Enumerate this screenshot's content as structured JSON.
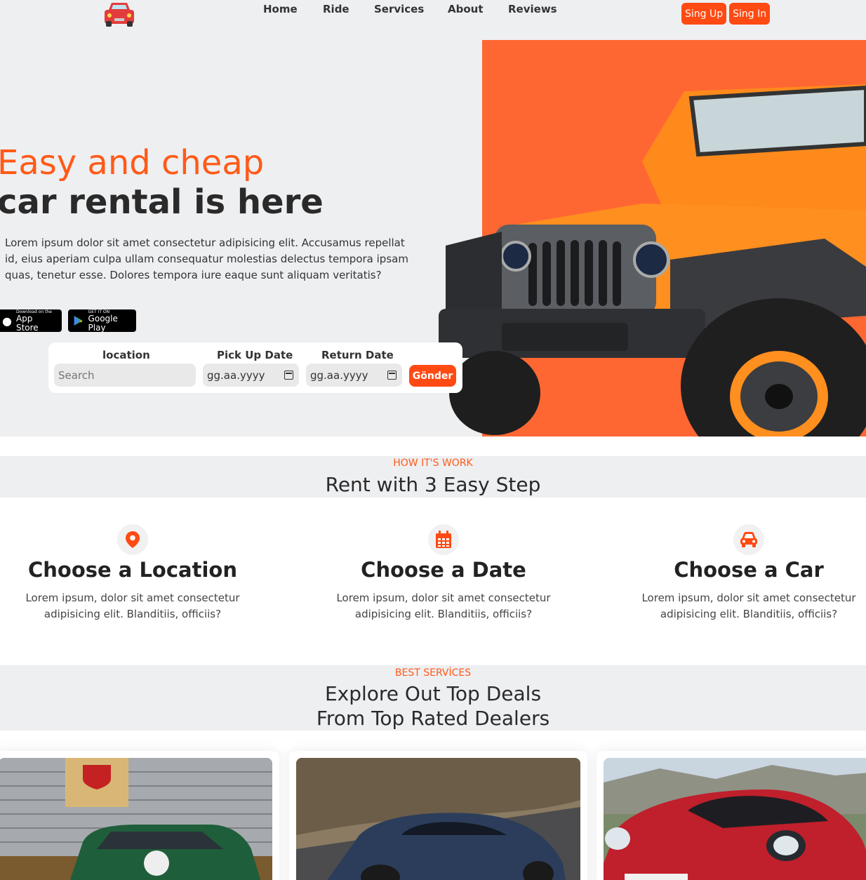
{
  "nav": {
    "items": [
      "Home",
      "Ride",
      "Services",
      "About",
      "Reviews"
    ],
    "signup_label": "Sing Up",
    "signin_label": "Sing In"
  },
  "hero": {
    "title_line1": "Easy and cheap",
    "title_line2": "car rental is here",
    "text": "Lorem ipsum dolor sit amet consectetur adipisicing elit. Accusamus repellat id, eius aperiam culpa ullam consequatur molestias delectus tempora ipsam quas, tenetur esse. Dolores tempora iure eaque sunt aliquam veritatis?",
    "app_store": {
      "small": "Download on the",
      "big": "App Store"
    },
    "google_play": {
      "small": "GET IT ON",
      "big": "Google Play"
    }
  },
  "search": {
    "location_label": "location",
    "location_placeholder": "Search",
    "pickup_label": "Pick Up Date",
    "pickup_value": "gg.aa.yyyy",
    "return_label": "Return Date",
    "return_value": "gg.aa.yyyy",
    "submit_label": "Gönder"
  },
  "how": {
    "kicker": "HOW IT'S WORK",
    "title": "Rent with 3 Easy Step",
    "steps": [
      {
        "title": "Choose a Location",
        "text": "Lorem ipsum, dolor sit amet consectetur adipisicing elit. Blanditiis, officiis?",
        "icon": "map-pin-icon"
      },
      {
        "title": "Choose a Date",
        "text": "Lorem ipsum, dolor sit amet consectetur adipisicing elit. Blanditiis, officiis?",
        "icon": "calendar-icon"
      },
      {
        "title": "Choose a Car",
        "text": "Lorem ipsum, dolor sit amet consectetur adipisicing elit. Blanditiis, officiis?",
        "icon": "car-icon"
      }
    ]
  },
  "services": {
    "kicker": "BEST SERVİCES",
    "title_line1": "Explore Out Top Deals",
    "title_line2": "From Top Rated Dealers"
  },
  "colors": {
    "accent": "#ff4a13",
    "hero_panel": "#ff6732",
    "background": "#eeeff1"
  }
}
